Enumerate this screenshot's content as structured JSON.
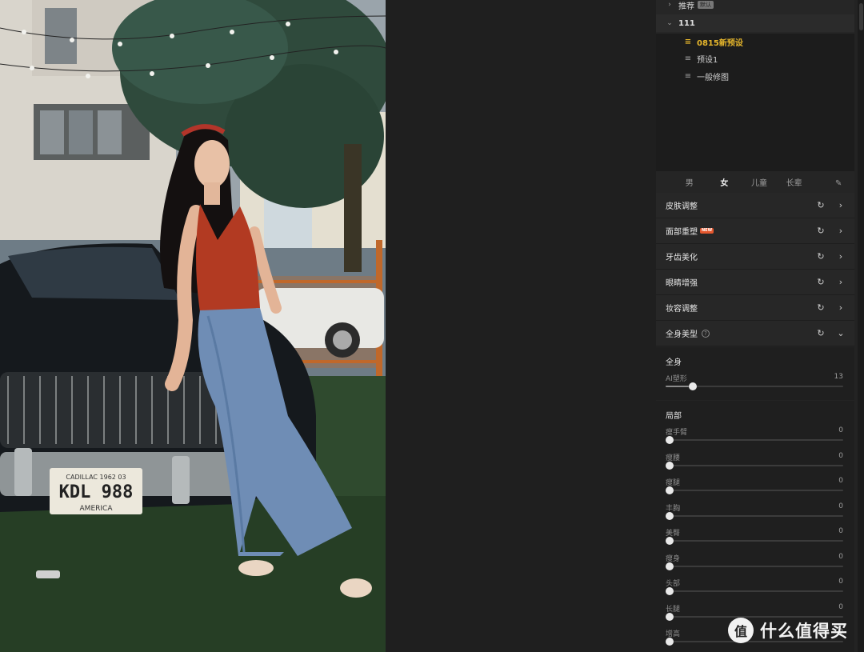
{
  "photo": {
    "plate_top": "CADILLAC 1962 03",
    "plate_main": "KDL 988",
    "plate_bottom": "AMERICA"
  },
  "presets": {
    "recommend_folder": {
      "label": "推荐",
      "tag": "默认"
    },
    "folder": {
      "label": "111",
      "expanded": true
    },
    "items": [
      {
        "label": "0815新预设",
        "active": true,
        "icon": "preset-list-icon"
      },
      {
        "label": "预设1",
        "active": false,
        "icon": "preset-list-icon"
      },
      {
        "label": "一般修图",
        "active": false,
        "icon": "preset-list-icon"
      }
    ]
  },
  "tabs": [
    {
      "label": "男",
      "active": false
    },
    {
      "label": "女",
      "active": true
    },
    {
      "label": "儿童",
      "active": false
    },
    {
      "label": "长辈",
      "active": false
    }
  ],
  "adjustments": [
    {
      "label": "皮肤调整",
      "expanded": false
    },
    {
      "label": "面部重塑",
      "badge": "NEW",
      "expanded": false
    },
    {
      "label": "牙齿美化",
      "expanded": false
    },
    {
      "label": "眼睛增强",
      "expanded": false
    },
    {
      "label": "妆容调整",
      "expanded": false
    },
    {
      "label": "全身美型",
      "expanded": true,
      "help": "?"
    }
  ],
  "body_full": {
    "title": "全身",
    "sliders": [
      {
        "label": "AI塑形",
        "value": 13,
        "max": 100
      }
    ]
  },
  "body_local": {
    "title": "局部",
    "sliders": [
      {
        "label": "瘦手臂",
        "value": 0,
        "max": 100
      },
      {
        "label": "瘦腰",
        "value": 0,
        "max": 100
      },
      {
        "label": "瘦腿",
        "value": 0,
        "max": 100
      },
      {
        "label": "丰胸",
        "value": 0,
        "max": 100
      },
      {
        "label": "美臀",
        "value": 0,
        "max": 100
      },
      {
        "label": "瘦身",
        "value": 0,
        "max": 100
      },
      {
        "label": "头部",
        "value": 0,
        "max": 100
      },
      {
        "label": "长腿",
        "value": 0,
        "max": 100
      },
      {
        "label": "增高",
        "value": 0,
        "max": 100
      }
    ]
  },
  "watermark": {
    "logo_text": "值",
    "text": "什么值得买"
  },
  "colors": {
    "accent": "#e6b62c",
    "panel": "#232323",
    "badge": "#e4572e"
  }
}
